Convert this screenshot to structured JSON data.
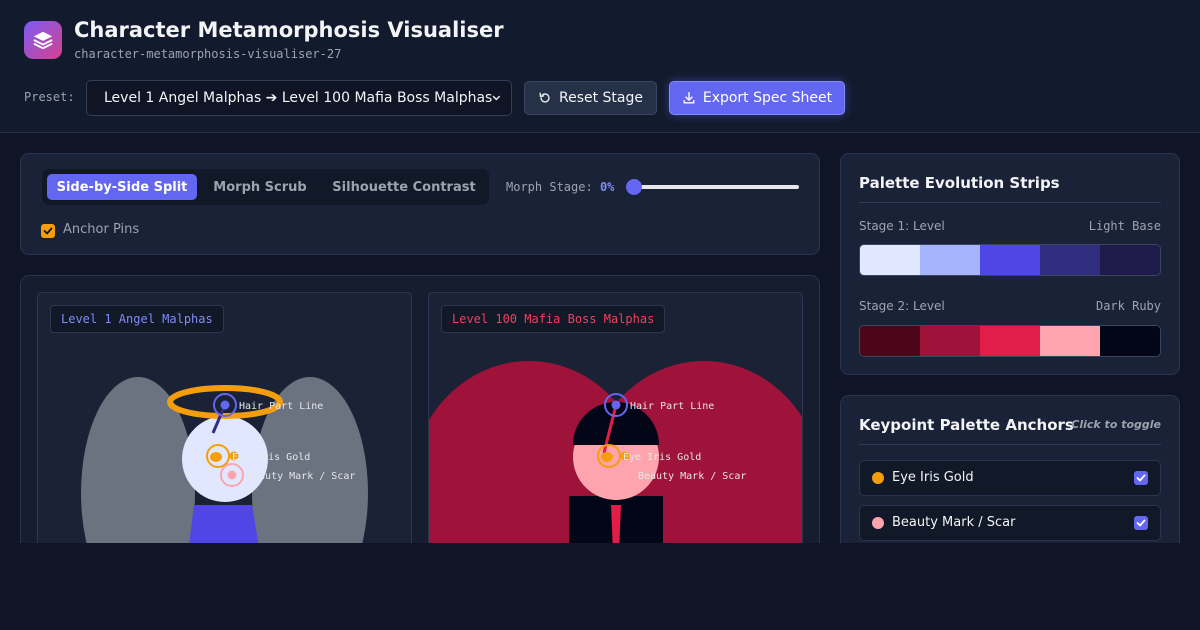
{
  "app": {
    "title": "Character Metamorphosis Visualiser",
    "subtitle": "character-metamorphosis-visualiser-27"
  },
  "toolbar": {
    "preset_label": "Preset:",
    "preset_value": "Level 1 Angel Malphas ➔ Level 100 Mafia Boss Malphas",
    "reset_label": "Reset Stage",
    "export_label": "Export Spec Sheet"
  },
  "controls": {
    "tabs": [
      {
        "label": "Side-by-Side Split",
        "active": true
      },
      {
        "label": "Morph Scrub",
        "active": false
      },
      {
        "label": "Silhouette Contrast",
        "active": false
      }
    ],
    "morph_stage_label": "Morph Stage:",
    "morph_stage_value": "0%",
    "morph_stage_fraction": 0,
    "anchor_pins_label": "Anchor Pins",
    "anchor_pins_checked": true
  },
  "stage": {
    "left": {
      "tag": "Level 1 Angel Malphas",
      "pins": {
        "hair": "Hair Part Line",
        "eye": "Eye Iris Gold",
        "mark": "Beauty Mark / Scar"
      }
    },
    "right": {
      "tag": "Level 100 Mafia Boss Malphas",
      "pins": {
        "hair": "Hair Part Line",
        "eye": "Eye Iris Gold",
        "mark": "Beauty Mark / Scar"
      }
    }
  },
  "palette": {
    "title": "Palette Evolution Strips",
    "strips": [
      {
        "label": "Stage 1: Level",
        "name": "Light Base",
        "colors": [
          "#e0e7ff",
          "#a5b4fc",
          "#4f46e5",
          "#312e81",
          "#1e1b4b"
        ]
      },
      {
        "label": "Stage 2: Level",
        "name": "Dark Ruby",
        "colors": [
          "#4c0519",
          "#9f1239",
          "#e11d48",
          "#fda4af",
          "#020617"
        ]
      }
    ]
  },
  "anchors": {
    "title": "Keypoint Palette Anchors",
    "hint": "Click to toggle",
    "items": [
      {
        "name": "Eye Iris Gold",
        "color": "#f59e0b",
        "checked": true
      },
      {
        "name": "Beauty Mark / Scar",
        "color": "#fda4af",
        "checked": true
      }
    ]
  },
  "colors": {
    "accent": "#6366f1",
    "angel_wing": "#6b7280",
    "angel_halo": "#f59e0b",
    "angel_body": "#4f46e5",
    "boss_wing": "#9f1239",
    "boss_skin": "#fda4af",
    "boss_suit": "#020617",
    "boss_tie": "#e11d48"
  }
}
